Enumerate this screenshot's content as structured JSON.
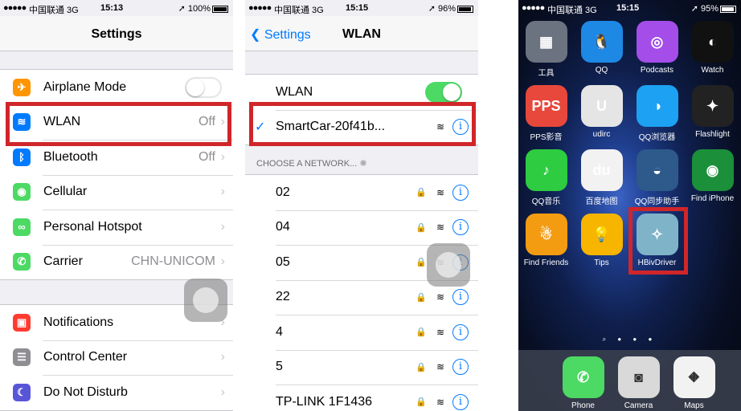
{
  "status1": {
    "signal": "●●●●●",
    "carrier": "中国联通 3G",
    "time": "15:13",
    "battery": "100%"
  },
  "status2": {
    "signal": "●●●●●",
    "carrier": "中国联通 3G",
    "time": "15:15",
    "battery": "96%"
  },
  "status3": {
    "signal": "●●●●●",
    "carrier": "中国联通 3G",
    "time": "15:15",
    "battery": "95%"
  },
  "settings": {
    "title": "Settings",
    "items": [
      {
        "label": "Airplane Mode",
        "detail": "",
        "icon": "airplane-icon",
        "color": "#ff9500"
      },
      {
        "label": "WLAN",
        "detail": "Off",
        "icon": "wifi-icon",
        "color": "#007aff"
      },
      {
        "label": "Bluetooth",
        "detail": "Off",
        "icon": "bluetooth-icon",
        "color": "#007aff"
      },
      {
        "label": "Cellular",
        "detail": "",
        "icon": "cellular-icon",
        "color": "#4cd964"
      },
      {
        "label": "Personal Hotspot",
        "detail": "",
        "icon": "hotspot-icon",
        "color": "#4cd964"
      },
      {
        "label": "Carrier",
        "detail": "CHN-UNICOM",
        "icon": "phone-icon",
        "color": "#4cd964"
      },
      {
        "label": "Notifications",
        "detail": "",
        "icon": "notifications-icon",
        "color": "#ff3b30"
      },
      {
        "label": "Control Center",
        "detail": "",
        "icon": "control-center-icon",
        "color": "#8e8e93"
      },
      {
        "label": "Do Not Disturb",
        "detail": "",
        "icon": "moon-icon",
        "color": "#5856d6"
      }
    ]
  },
  "wlan": {
    "back": "Settings",
    "title": "WLAN",
    "toggle_label": "WLAN",
    "connected": "SmartCar-20f41b...",
    "choose_header": "CHOOSE A NETWORK...",
    "networks": [
      "02",
      "04",
      "05",
      "22",
      "4",
      "5",
      "TP-LINK 1F1436"
    ]
  },
  "home": {
    "apps": [
      {
        "label": "工具",
        "color": "#6b7280"
      },
      {
        "label": "QQ",
        "color": "#1e88e5"
      },
      {
        "label": "Podcasts",
        "color": "#a44de8"
      },
      {
        "label": "Watch",
        "color": "#111111"
      },
      {
        "label": "PPS影音",
        "color": "#e7483b"
      },
      {
        "label": "udirc",
        "color": "#e5e5e5"
      },
      {
        "label": "QQ浏览器",
        "color": "#1da1f2"
      },
      {
        "label": "Flashlight",
        "color": "#222222"
      },
      {
        "label": "QQ音乐",
        "color": "#2ecc40"
      },
      {
        "label": "百度地图",
        "color": "#f2f2f2"
      },
      {
        "label": "QQ同步助手",
        "color": "#2d5a8a"
      },
      {
        "label": "Find iPhone",
        "color": "#1b8f3a"
      },
      {
        "label": "Find Friends",
        "color": "#f39c12"
      },
      {
        "label": "Tips",
        "color": "#f7b500"
      },
      {
        "label": "HBivDriver",
        "color": "#7fb4c8"
      }
    ],
    "dock": [
      {
        "label": "Phone",
        "color": "#4cd964"
      },
      {
        "label": "Camera",
        "color": "#d9d9d9"
      },
      {
        "label": "Maps",
        "color": "#f2f2f2"
      }
    ]
  },
  "accent": {
    "blue": "#007aff",
    "highlight": "#d0262a",
    "green": "#4cd964"
  }
}
